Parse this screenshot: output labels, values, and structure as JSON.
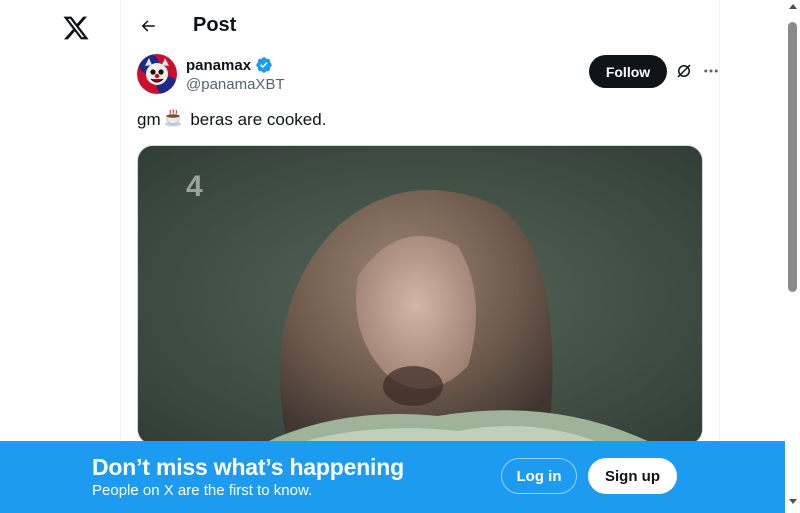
{
  "header": {
    "title": "Post"
  },
  "post": {
    "author": {
      "display_name": "panamax",
      "handle": "@panamaXBT",
      "verified": true
    },
    "follow_label": "Follow",
    "text_before": "gm",
    "text_after": " beras are cooked.",
    "emoji": "hot-beverage",
    "media": {
      "type": "video",
      "channel_logo": "4"
    }
  },
  "bottom_bar": {
    "title": "Don’t miss what’s happening",
    "subtitle": "People on X are the first to know.",
    "login_label": "Log in",
    "signup_label": "Sign up",
    "background": "#1d9bf0"
  },
  "colors": {
    "accent": "#1d9bf0",
    "text": "#0f1419",
    "muted": "#536471"
  }
}
